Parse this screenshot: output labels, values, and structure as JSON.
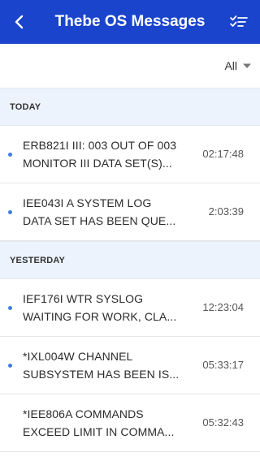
{
  "header": {
    "title": "Thebe OS Messages",
    "back_icon": "chevron-left-icon",
    "filter_icon": "checklist-filter-icon",
    "background_color": "#1a44cc"
  },
  "filter": {
    "selected": "All",
    "icon": "caret-down-icon"
  },
  "sections": [
    {
      "label": "TODAY",
      "messages": [
        {
          "line1": "ERB821I III: 003 OUT OF 003",
          "line2": "MONITOR III DATA SET(S)...",
          "time": "02:17:48",
          "unread": true
        },
        {
          "line1": "IEE043I A SYSTEM LOG",
          "line2": "DATA SET HAS BEEN QUE...",
          "time": "2:03:39",
          "unread": true
        }
      ]
    },
    {
      "label": "YESTERDAY",
      "messages": [
        {
          "line1": "IEF176I WTR SYSLOG",
          "line2": "WAITING FOR WORK, CLA...",
          "time": "12:23:04",
          "unread": true
        },
        {
          "line1": "*IXL004W CHANNEL",
          "line2": "SUBSYSTEM HAS BEEN IS...",
          "time": "05:33:17",
          "unread": true
        },
        {
          "line1": "*IEE806A COMMANDS",
          "line2": "EXCEED LIMIT IN COMMA...",
          "time": "05:32:43",
          "unread": false
        }
      ]
    }
  ],
  "colors": {
    "unread_dot": "#3e7fe0",
    "section_background": "#edf3fd"
  }
}
